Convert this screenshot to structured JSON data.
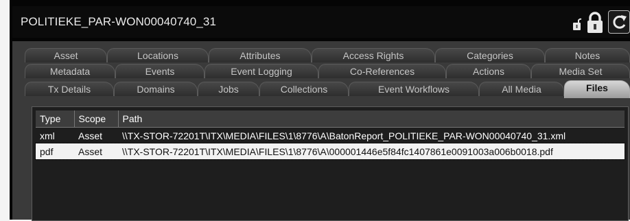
{
  "window": {
    "title": "POLITIEKE_PAR-WON00040740_31"
  },
  "icons": [
    "unlocked-padlock-icon",
    "padlock-icon",
    "refresh-icon"
  ],
  "tabs": {
    "row1": [
      "Asset",
      "Locations",
      "Attributes",
      "Access Rights",
      "Categories",
      "Notes"
    ],
    "row2": [
      "Metadata",
      "Events",
      "Event Logging",
      "Co-References",
      "Actions",
      "Media Set"
    ],
    "row3": [
      "Tx Details",
      "Domains",
      "Jobs",
      "Collections",
      "Event Workflows",
      "All Media",
      "Files"
    ],
    "active": "Files"
  },
  "files_table": {
    "columns": [
      "Type",
      "Scope",
      "Path"
    ],
    "rows": [
      {
        "type": "xml",
        "scope": "Asset",
        "path": "\\\\TX-STOR-72201T\\ITX\\MEDIA\\FILES\\1\\8776\\A\\BatonReport_POLITIEKE_PAR-WON00040740_31.xml"
      },
      {
        "type": "pdf",
        "scope": "Asset",
        "path": "\\\\TX-STOR-72201T\\ITX\\MEDIA\\FILES\\1\\8776\\A\\000001446e5f84fc1407861e0091003a006b0018.pdf"
      }
    ],
    "selected_row": 1
  },
  "colors": {
    "window_bg": "#050505",
    "tab_bg": "#3a3a3a",
    "active_tab": "#c0c0c0",
    "selected_row": "#f2f2f2"
  }
}
